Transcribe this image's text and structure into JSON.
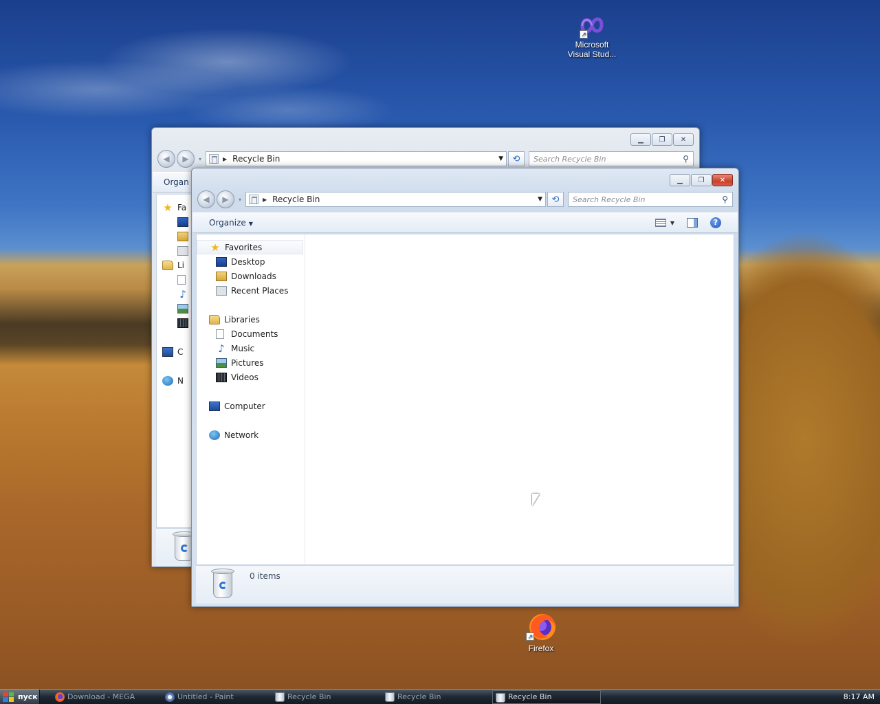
{
  "desktop": {
    "icons": [
      {
        "label_line1": "Microsoft",
        "label_line2": "Visual Stud...",
        "icon": "visual-studio-icon"
      },
      {
        "label_line1": "Firefox",
        "label_line2": "",
        "icon": "firefox-icon"
      }
    ]
  },
  "back_window": {
    "address": "Recycle Bin",
    "search_placeholder": "Search Recycle Bin",
    "organize_fragment": "Organ",
    "nav_fragments": [
      "Fa",
      "Li",
      "C",
      "N"
    ]
  },
  "front_window": {
    "address": "Recycle Bin",
    "search_placeholder": "Search Recycle Bin",
    "organize_label": "Organize",
    "nav": {
      "favorites": "Favorites",
      "favorites_items": [
        "Desktop",
        "Downloads",
        "Recent Places"
      ],
      "libraries": "Libraries",
      "libraries_items": [
        "Documents",
        "Music",
        "Pictures",
        "Videos"
      ],
      "computer": "Computer",
      "network": "Network"
    },
    "status": "0 items"
  },
  "taskbar": {
    "start_label": "пуск",
    "tasks": [
      {
        "label": "Download - MEGA",
        "icon": "firefox-icon"
      },
      {
        "label": "Untitled - Paint",
        "icon": "paint-icon"
      },
      {
        "label": "Recycle Bin",
        "icon": "recycle-bin-icon"
      },
      {
        "label": "Recycle Bin",
        "icon": "recycle-bin-icon"
      },
      {
        "label": "Recycle Bin",
        "icon": "recycle-bin-icon",
        "active": true
      }
    ],
    "clock": "8:17 AM"
  }
}
